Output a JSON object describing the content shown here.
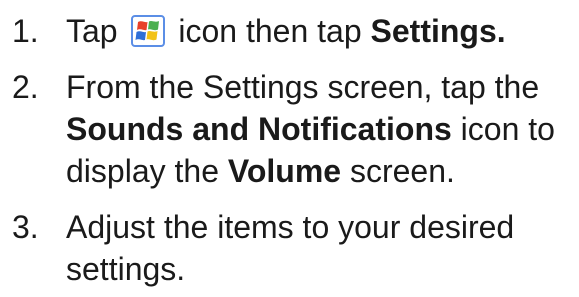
{
  "steps": [
    {
      "number": "1.",
      "lines": [
        {
          "before_icon": "Tap",
          "after_icon": "icon then tap",
          "bold": "Settings."
        }
      ],
      "icon": "windows-start-icon"
    },
    {
      "number": "2.",
      "lines": [
        {
          "text": "From the Settings screen, tap the"
        },
        {
          "bold": "Sounds and Notifications",
          "text": "icon to"
        },
        {
          "text": "display the",
          "bold": "Volume",
          "text2": "screen."
        }
      ]
    },
    {
      "number": "3.",
      "lines": [
        {
          "text": "Adjust the items to your desired"
        },
        {
          "text": "settings."
        }
      ]
    }
  ],
  "colors": {
    "text": "#1a1a1a",
    "icon_red": "#e8402a",
    "icon_green": "#4caf50",
    "icon_blue": "#2e6fd8",
    "icon_yellow": "#f2c218",
    "icon_frame": "#5b8ee6"
  }
}
